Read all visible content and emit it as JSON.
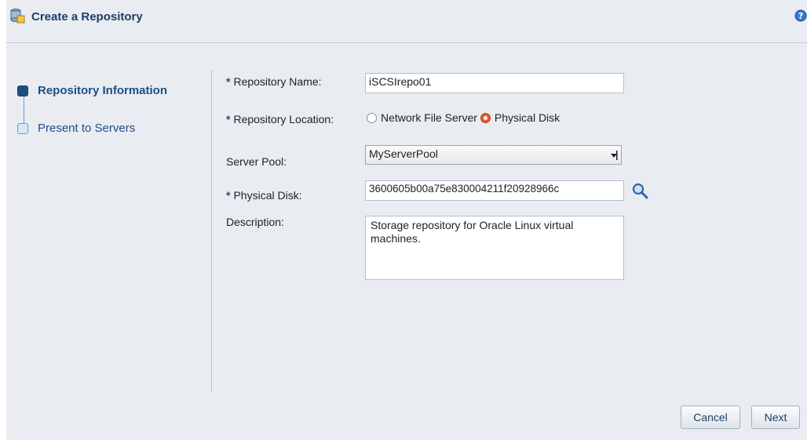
{
  "dialog": {
    "title": "Create a Repository",
    "help_icon": "help-icon",
    "title_icon": "repository-icon"
  },
  "train": {
    "steps": [
      {
        "label": "Repository Information",
        "state": "current"
      },
      {
        "label": "Present to Servers",
        "state": "pending"
      }
    ]
  },
  "form": {
    "required_marker": "*",
    "repository_name": {
      "label": "Repository Name:",
      "value": "iSCSIrepo01"
    },
    "repository_location": {
      "label": "Repository Location:",
      "options": [
        "Network File Server",
        "Physical Disk"
      ],
      "selected": "Physical Disk"
    },
    "server_pool": {
      "label": "Server Pool:",
      "value": "MyServerPool"
    },
    "physical_disk": {
      "label": "Physical Disk:",
      "value": "3600605b00a75e830004211f20928966c",
      "search_icon": "search-icon"
    },
    "description": {
      "label": "Description:",
      "value": "Storage repository for Oracle Linux virtual machines."
    }
  },
  "buttons": {
    "cancel": "Cancel",
    "next": "Next"
  },
  "colors": {
    "accent": "#1b4f86",
    "radio_selected": "#e65a2b",
    "background": "#e9ecf1"
  }
}
